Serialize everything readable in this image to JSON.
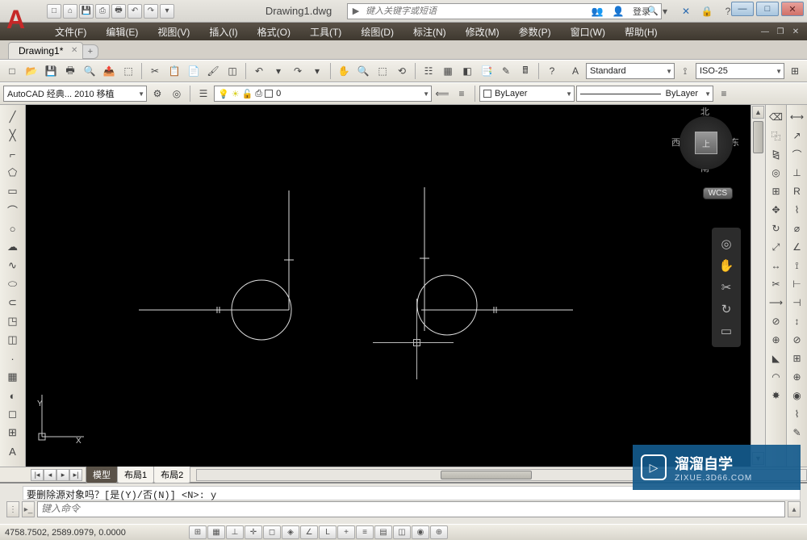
{
  "title_bar": {
    "filename": "Drawing1.dwg",
    "search_placeholder": "键入关键字或短语",
    "login_label": "登录",
    "qat_icons": [
      "new-icon",
      "open-icon",
      "save-icon",
      "saveas-icon",
      "print-icon",
      "undo-icon",
      "redo-icon",
      "dropdown-icon"
    ]
  },
  "menu": {
    "items": [
      "文件(F)",
      "编辑(E)",
      "视图(V)",
      "插入(I)",
      "格式(O)",
      "工具(T)",
      "绘图(D)",
      "标注(N)",
      "修改(M)",
      "参数(P)",
      "窗口(W)",
      "帮助(H)"
    ]
  },
  "file_tabs": {
    "tab1": "Drawing1*"
  },
  "toolbar1": {
    "style_label": "Standard",
    "dim_style_label": "ISO-25"
  },
  "toolbar2": {
    "workspace_label": "AutoCAD 经典... 2010 移植",
    "layer_label": "0",
    "bylayer1": "ByLayer",
    "bylayer2": "ByLayer"
  },
  "layout_tabs": {
    "t1": "模型",
    "t2": "布局1",
    "t3": "布局2"
  },
  "viewcube": {
    "n": "北",
    "s": "南",
    "e": "东",
    "w": "西",
    "top": "上",
    "wcs": "WCS"
  },
  "command": {
    "history": "要删除源对象吗？[是(Y)/否(N)]  <N>: y",
    "prompt_placeholder": "键入命令"
  },
  "status": {
    "coords": "4758.7502, 2589.0979, 0.0000"
  },
  "watermark": {
    "brand": "溜溜自学",
    "url": "ZIXUE.3D66.COM"
  },
  "ucs": {
    "x": "X",
    "y": "Y"
  }
}
